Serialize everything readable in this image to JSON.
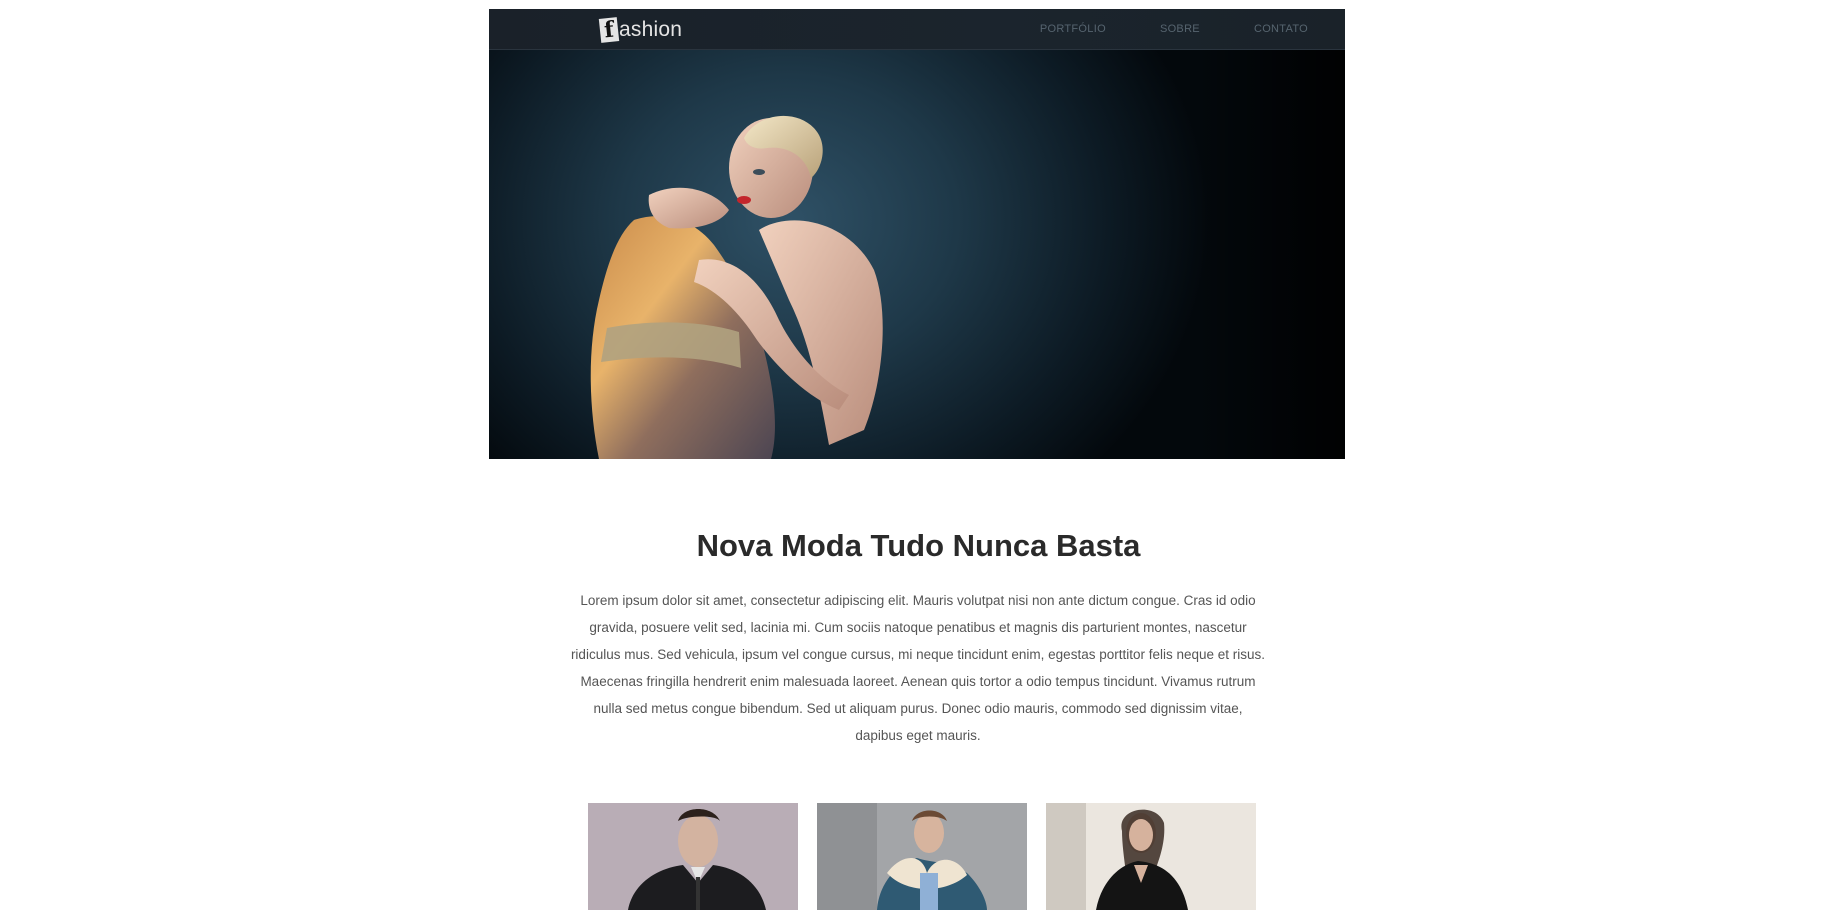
{
  "header": {
    "logo_mark": "f",
    "logo_text": "ashion",
    "nav": [
      {
        "label": "PORTFÓLIO"
      },
      {
        "label": "SOBRE"
      },
      {
        "label": "CONTATO"
      }
    ]
  },
  "hero": {
    "image": "fashion-model-photo"
  },
  "main": {
    "title": "Nova Moda Tudo Nunca Basta",
    "intro_lines": [
      "Lorem ipsum dolor sit amet, consectetur adipiscing elit. Mauris volutpat nisi non ante dictum congue. Cras id odio",
      "gravida, posuere velit sed, lacinia mi. Cum sociis natoque penatibus et magnis dis parturient montes, nascetur",
      "ridiculus mus. Sed vehicula, ipsum vel congue cursus, mi neque tincidunt enim, egestas porttitor felis neque et risus.",
      "Maecenas fringilla hendrerit enim malesuada laoreet. Aenean quis tortor a odio tempus tincidunt. Vivamus rutrum",
      "nulla sed metus congue bibendum. Sed ut aliquam purus. Donec odio mauris, commodo sed dignissim vitae,",
      "dapibus eget mauris."
    ]
  },
  "gallery": {
    "items": [
      {
        "image": "man-black-coat-photo"
      },
      {
        "image": "woman-fur-jacket-photo"
      },
      {
        "image": "woman-leather-jacket-photo"
      }
    ]
  },
  "colors": {
    "header_bg": "#1a2129",
    "nav_text": "#56646f",
    "title_text": "#2a2a2a",
    "body_text": "#555555"
  }
}
